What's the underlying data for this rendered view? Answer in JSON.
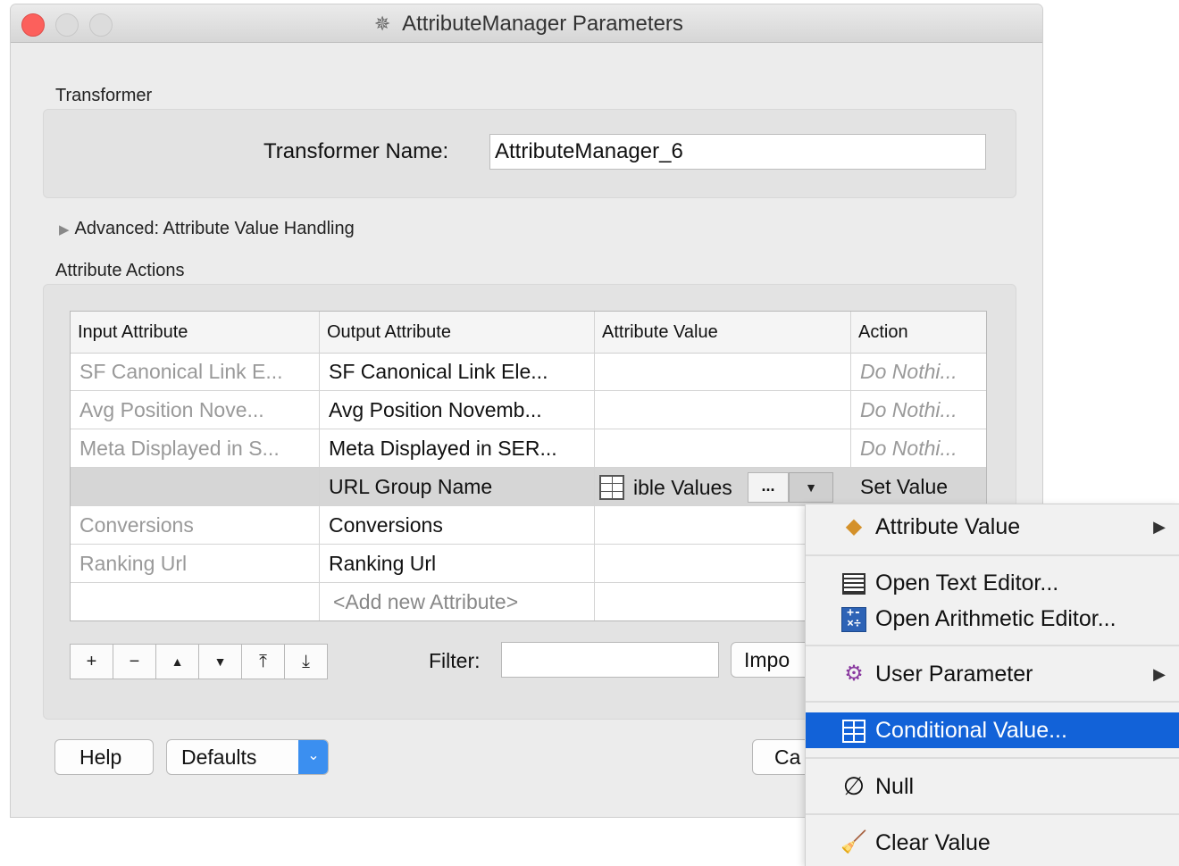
{
  "window": {
    "title": "AttributeManager Parameters",
    "title_icon": "transformer-icon"
  },
  "sections": {
    "transformer": "Transformer",
    "advanced": "Advanced: Attribute Value Handling",
    "attribute_actions": "Attribute Actions"
  },
  "transformer_name": {
    "label": "Transformer Name:",
    "value": "AttributeManager_6"
  },
  "table": {
    "headers": [
      "Input Attribute",
      "Output Attribute",
      "Attribute Value",
      "Action"
    ],
    "rows": [
      {
        "input": "SF Canonical Link E...",
        "output": "SF Canonical Link Ele...",
        "value": "",
        "action": "Do Nothi..."
      },
      {
        "input": "Avg Position Nove...",
        "output": "Avg Position Novemb...",
        "value": "",
        "action": "Do Nothi..."
      },
      {
        "input": "Meta Displayed in S...",
        "output": "Meta Displayed in SER...",
        "value": "",
        "action": "Do Nothi..."
      },
      {
        "input": "",
        "output": "URL Group Name",
        "value": "ible Values",
        "action": "Set Value"
      },
      {
        "input": "Conversions",
        "output": "Conversions",
        "value": "",
        "action": ""
      },
      {
        "input": "Ranking Url",
        "output": "Ranking Url",
        "value": "",
        "action": ""
      },
      {
        "input": "",
        "output": "<Add new Attribute>",
        "value": "",
        "action": ""
      }
    ],
    "selected_row": 3,
    "ellipsis_label": "...",
    "dropdown_glyph": "▼"
  },
  "toolbar": {
    "buttons": [
      {
        "name": "add-row-button",
        "glyph": "+"
      },
      {
        "name": "remove-row-button",
        "glyph": "−"
      },
      {
        "name": "move-up-button",
        "glyph": "▲"
      },
      {
        "name": "move-down-button",
        "glyph": "▼"
      },
      {
        "name": "move-top-button",
        "glyph": "⤒"
      },
      {
        "name": "move-bottom-button",
        "glyph": "⤓"
      }
    ],
    "filter_label": "Filter:",
    "filter_value": "",
    "import_label": "Impo"
  },
  "footer": {
    "help": "Help",
    "defaults": "Defaults",
    "cancel": "Ca"
  },
  "context_menu": {
    "attribute_value": "Attribute Value",
    "open_text_editor": "Open Text Editor...",
    "open_arithmetic_editor": "Open Arithmetic Editor...",
    "user_parameter": "User Parameter",
    "conditional_value": "Conditional Value...",
    "null": "Null",
    "clear_value": "Clear Value",
    "submenu_arrow": "▶",
    "icons": {
      "attribute_value": "attribute-value-icon",
      "text_editor": "text-editor-icon",
      "arithmetic_editor": "arithmetic-editor-icon",
      "user_parameter": "user-parameter-gear-icon",
      "conditional_value": "conditional-table-icon",
      "null": "null-icon",
      "clear_value": "broom-icon"
    }
  },
  "colors": {
    "accent": "#1262d8",
    "defaults_arrow": "#3b8ff0",
    "close": "#fc605c"
  }
}
